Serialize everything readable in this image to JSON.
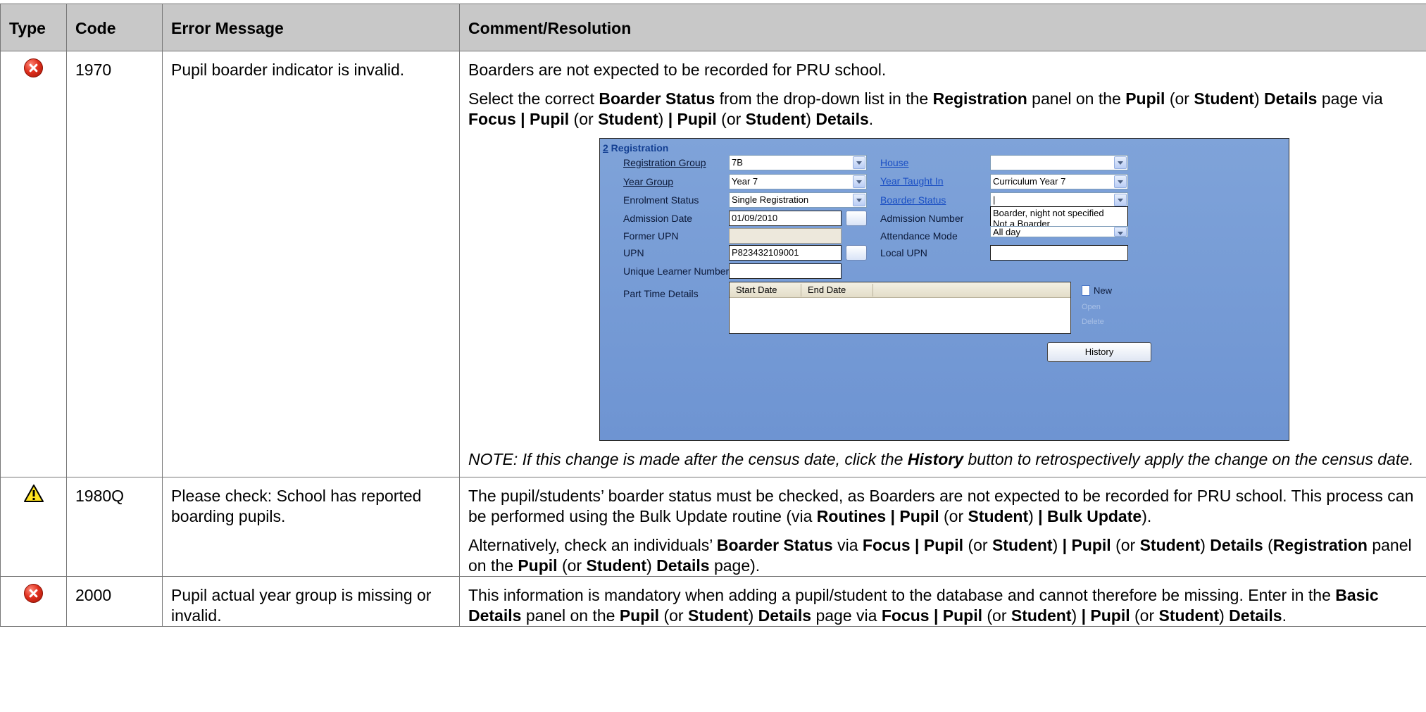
{
  "headers": {
    "type": "Type",
    "code": "Code",
    "message": "Error Message",
    "comment": "Comment/Resolution"
  },
  "rows": [
    {
      "icon": "error-icon",
      "code": "1970",
      "message": "Pupil boarder indicator is invalid.",
      "comment_p1": "Boarders are not expected to be recorded for PRU school.",
      "comment_p2": {
        "t1": "Select the correct ",
        "b1": "Boarder Status",
        "t2": " from the drop-down list in the ",
        "b2": "Registration",
        "t3": " panel on the ",
        "b3": "Pupil",
        "t4": " (or ",
        "b4": "Student",
        "t5": ") ",
        "b5": "Details",
        "t6": " page via ",
        "b6": "Focus | Pupil",
        "t7": " (or ",
        "b7": "Student",
        "t8": ") ",
        "b8": "| Pupil",
        "t9": " (or ",
        "b9": "Student",
        "t10": ") ",
        "b10": "Details",
        "t11": "."
      },
      "note": {
        "t1": "NOTE: If this change is made after the census date, click the ",
        "b1": "History",
        "t2": " button to retrospectively apply the change on the census date."
      }
    },
    {
      "icon": "warning-icon",
      "code": "1980Q",
      "message": "Please check: School has reported boarding pupils.",
      "comment_p1": {
        "t1": "The pupil/students’ boarder status must be checked, as Boarders are not expected to be recorded for PRU school. This process can be performed using the Bulk Update routine (via ",
        "b1": "Routines | Pupil",
        "t2": " (or ",
        "b2": "Student",
        "t3": ") ",
        "b3": "| Bulk Update",
        "t4": ")."
      },
      "comment_p2": {
        "t1": "Alternatively, check an individuals’ ",
        "b1": "Boarder Status",
        "t2": " via ",
        "b2": "Focus | Pupil",
        "t3": " (or ",
        "b3": "Student",
        "t4": ") ",
        "b4": "| Pupil",
        "t5": " (or ",
        "b5": "Student",
        "t6": ") ",
        "b6": "Details",
        "t7": " (",
        "b7": "Registration",
        "t8": " panel on the ",
        "b8": "Pupil",
        "t9": " (or ",
        "b9": "Student",
        "t10": ") ",
        "b10": "Details",
        "t11": " page)."
      }
    },
    {
      "icon": "error-icon",
      "code": "2000",
      "message": "Pupil actual year group is missing or invalid.",
      "comment_p1": {
        "t1": "This information is mandatory when adding a pupil/student to the database and cannot therefore be missing. Enter in the ",
        "b1": "Basic Details",
        "t2": " panel on the ",
        "b2": "Pupil",
        "t3": " (or ",
        "b3": "Student",
        "t4": ") ",
        "b4": "Details",
        "t5": " page via ",
        "b5": "Focus | Pupil",
        "t6": " (or ",
        "b6": "Student",
        "t7": ") ",
        "b7": "| Pupil",
        "t8": " (or ",
        "b8": "Student",
        "t9": ") ",
        "b9": "Details",
        "t10": "."
      }
    }
  ],
  "panel": {
    "title_num": "2",
    "title_text": " Registration",
    "reg_group_label": "Registration Group",
    "reg_group_value": "7B",
    "year_group_label": "Year Group",
    "year_group_value": "Year  7",
    "enrolment_label": "Enrolment Status",
    "enrolment_value": "Single Registration",
    "admission_date_label": "Admission Date",
    "admission_date_value": "01/09/2010",
    "former_upn_label": "Former UPN",
    "upn_label": "UPN",
    "upn_value": "P823432109001",
    "uln_label": "Unique Learner Number",
    "part_time_label": "Part Time Details",
    "grid_col1": "Start Date",
    "grid_col2": "End Date",
    "house_label": "House",
    "house_value": "",
    "year_taught_label": "Year Taught In",
    "year_taught_value": "Curriculum Year  7",
    "boarder_label": "Boarder Status",
    "boarder_value": "|",
    "boarder_options": [
      "Boarder, night not specified",
      "Not a Boarder"
    ],
    "admission_number_label": "Admission Number",
    "attendance_label": "Attendance Mode",
    "attendance_value": "All day",
    "local_upn_label": "Local UPN",
    "new_label": "New",
    "open_label": "Open",
    "delete_label": "Delete",
    "history_label": "History"
  }
}
